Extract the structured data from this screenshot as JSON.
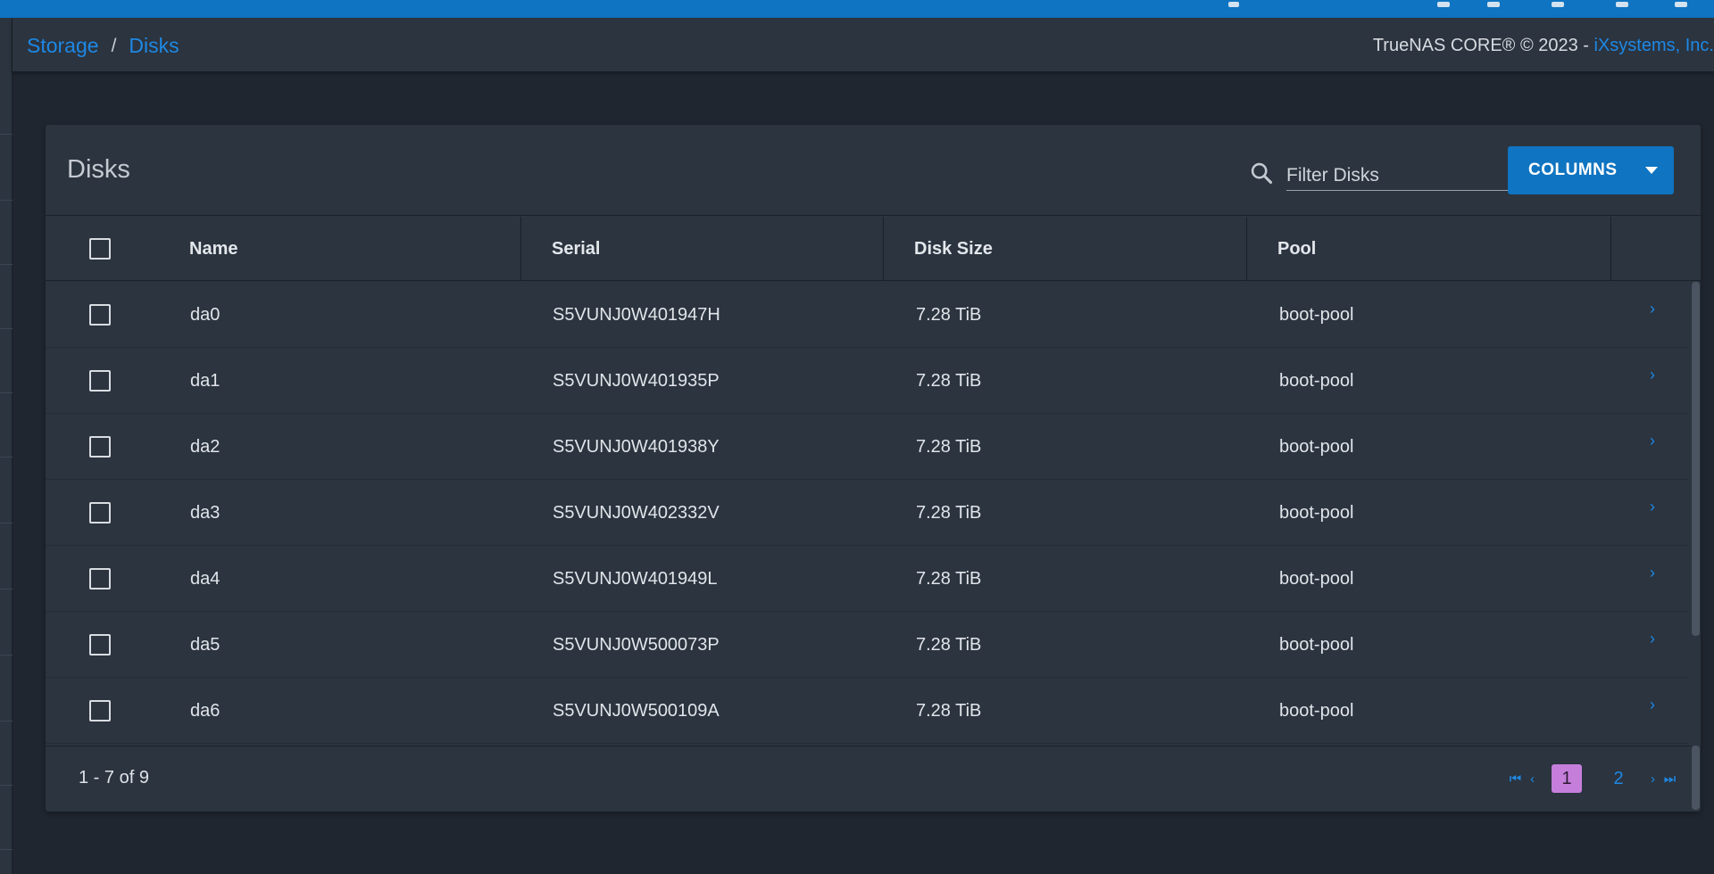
{
  "breadcrumb": {
    "items": [
      "Storage",
      "Disks"
    ],
    "separator": "/"
  },
  "copyright": {
    "text": "TrueNAS CORE® © 2023 - ",
    "link": "iXsystems, Inc."
  },
  "card": {
    "title": "Disks",
    "filter_placeholder": "Filter Disks",
    "columns_label": "COLUMNS"
  },
  "table": {
    "headers": {
      "name": "Name",
      "serial": "Serial",
      "size": "Disk Size",
      "pool": "Pool"
    },
    "rows": [
      {
        "name": "da0",
        "serial": "S5VUNJ0W401947H",
        "size": "7.28 TiB",
        "pool": "boot-pool"
      },
      {
        "name": "da1",
        "serial": "S5VUNJ0W401935P",
        "size": "7.28 TiB",
        "pool": "boot-pool"
      },
      {
        "name": "da2",
        "serial": "S5VUNJ0W401938Y",
        "size": "7.28 TiB",
        "pool": "boot-pool"
      },
      {
        "name": "da3",
        "serial": "S5VUNJ0W402332V",
        "size": "7.28 TiB",
        "pool": "boot-pool"
      },
      {
        "name": "da4",
        "serial": "S5VUNJ0W401949L",
        "size": "7.28 TiB",
        "pool": "boot-pool"
      },
      {
        "name": "da5",
        "serial": "S5VUNJ0W500073P",
        "size": "7.28 TiB",
        "pool": "boot-pool"
      },
      {
        "name": "da6",
        "serial": "S5VUNJ0W500109A",
        "size": "7.28 TiB",
        "pool": "boot-pool"
      }
    ]
  },
  "pagination": {
    "range": "1 - 7 of 9",
    "pages": [
      "1",
      "2"
    ],
    "current": "1"
  },
  "colors": {
    "accent": "#0f74c1",
    "link": "#1e88e5",
    "active_page": "#c57fdb",
    "background": "#1f2630",
    "surface": "#2b343f"
  }
}
